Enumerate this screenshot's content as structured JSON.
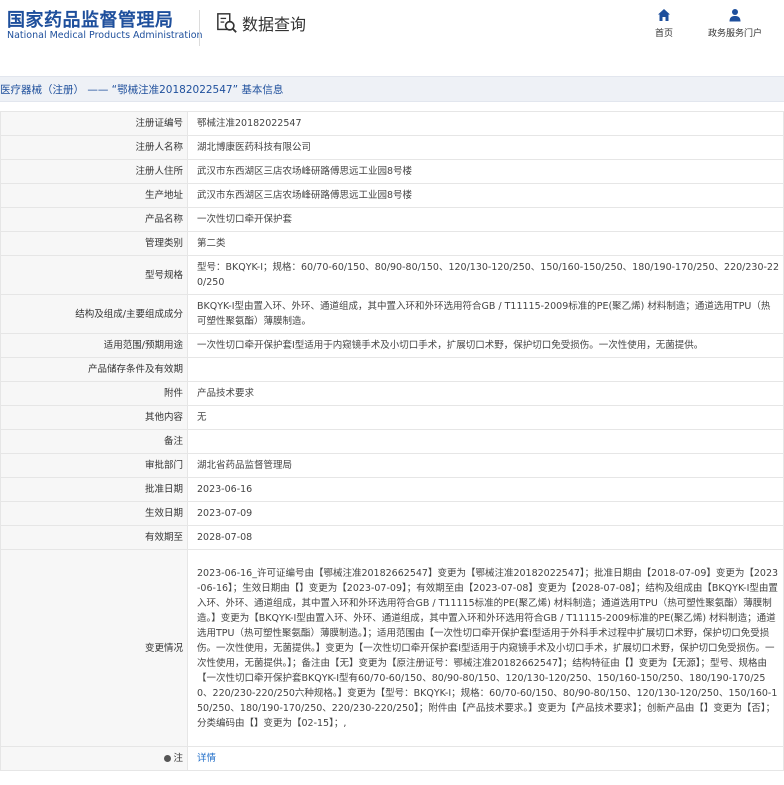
{
  "header": {
    "logo_cn": "国家药品监督管理局",
    "logo_en": "National Medical Products Administration",
    "search_title": "数据查询",
    "nav_home": "首页",
    "nav_portal": "政务服务门户",
    "brand_color": "#1e4f9c"
  },
  "breadcrumb": "医疗器械（注册） —— “鄂械注准20182022547” 基本信息",
  "rows": [
    {
      "label": "注册证编号",
      "value": "鄂械注准20182022547"
    },
    {
      "label": "注册人名称",
      "value": "湖北博康医药科技有限公司"
    },
    {
      "label": "注册人住所",
      "value": "武汉市东西湖区三店农场峰研路傅思远工业园8号楼"
    },
    {
      "label": "生产地址",
      "value": "武汉市东西湖区三店农场峰研路傅思远工业园8号楼"
    },
    {
      "label": "产品名称",
      "value": "一次性切口牵开保护套"
    },
    {
      "label": "管理类别",
      "value": "第二类"
    },
    {
      "label": "型号规格",
      "value": "型号：BKQYK-Ⅰ；规格：60/70-60/150、80/90-80/150、120/130-120/250、150/160-150/250、180/190-170/250、220/230-220/250"
    },
    {
      "label": "结构及组成/主要组成成分",
      "value": "BKQYK-Ⅰ型由置入环、外环、通道组成，其中置入环和外环选用符合GB / T11115-2009标准的PE(聚乙烯) 材料制造；通道选用TPU（热可塑性聚氨酯）薄膜制造。"
    },
    {
      "label": "适用范围/预期用途",
      "value": "一次性切口牵开保护套Ⅰ型适用于内窥镜手术及小切口手术，扩展切口术野，保护切口免受损伤。一次性使用，无菌提供。"
    },
    {
      "label": "产品储存条件及有效期",
      "value": ""
    },
    {
      "label": "附件",
      "value": "产品技术要求"
    },
    {
      "label": "其他内容",
      "value": "无"
    },
    {
      "label": "备注",
      "value": ""
    },
    {
      "label": "审批部门",
      "value": "湖北省药品监督管理局"
    },
    {
      "label": "批准日期",
      "value": "2023-06-16"
    },
    {
      "label": "生效日期",
      "value": "2023-07-09"
    },
    {
      "label": "有效期至",
      "value": "2028-07-08"
    },
    {
      "label": "变更情况",
      "value": "2023-06-16_许可证编号由【鄂械注准20182662547】变更为【鄂械注准20182022547】；批准日期由【2018-07-09】变更为【2023-06-16】；生效日期由【】变更为【2023-07-09】；有效期至由【2023-07-08】变更为【2028-07-08】；结构及组成由【BKQYK-Ⅰ型由置入环、外环、通道组成，其中置入环和外环选用符合GB / T11115标准的PE(聚乙烯) 材料制造；通道选用TPU（热可塑性聚氨酯）薄膜制造。】变更为【BKQYK-Ⅰ型由置入环、外环、通道组成，其中置入环和外环选用符合GB / T11115-2009标准的PE(聚乙烯) 材料制造；通道选用TPU（热可塑性聚氨酯）薄膜制造。】；适用范围由【一次性切口牵开保护套Ⅰ型适用于外科手术过程中扩展切口术野，保护切口免受损伤。一次性使用，无菌提供。】变更为【一次性切口牵开保护套Ⅰ型适用于内窥镜手术及小切口手术，扩展切口术野，保护切口免受损伤。一次性使用，无菌提供。】；备注由【无】变更为【原注册证号：鄂械注准20182662547】；结构特征由【】变更为【无源】；型号、规格由【一次性切口牵开保护套BKQYK-Ⅰ型有60/70-60/150、80/90-80/150、120/130-120/250、150/160-150/250、180/190-170/250、220/230-220/250六种规格。】变更为【型号：BKQYK-Ⅰ；规格：60/70-60/150、80/90-80/150、120/130-120/250、150/160-150/250、180/190-170/250、220/230-220/250】；附件由【产品技术要求。】变更为【产品技术要求】；创新产品由【】变更为【否】；分类编码由【】变更为【02-15】；,"
    }
  ],
  "note_row": {
    "label": "注",
    "link": "详情"
  }
}
